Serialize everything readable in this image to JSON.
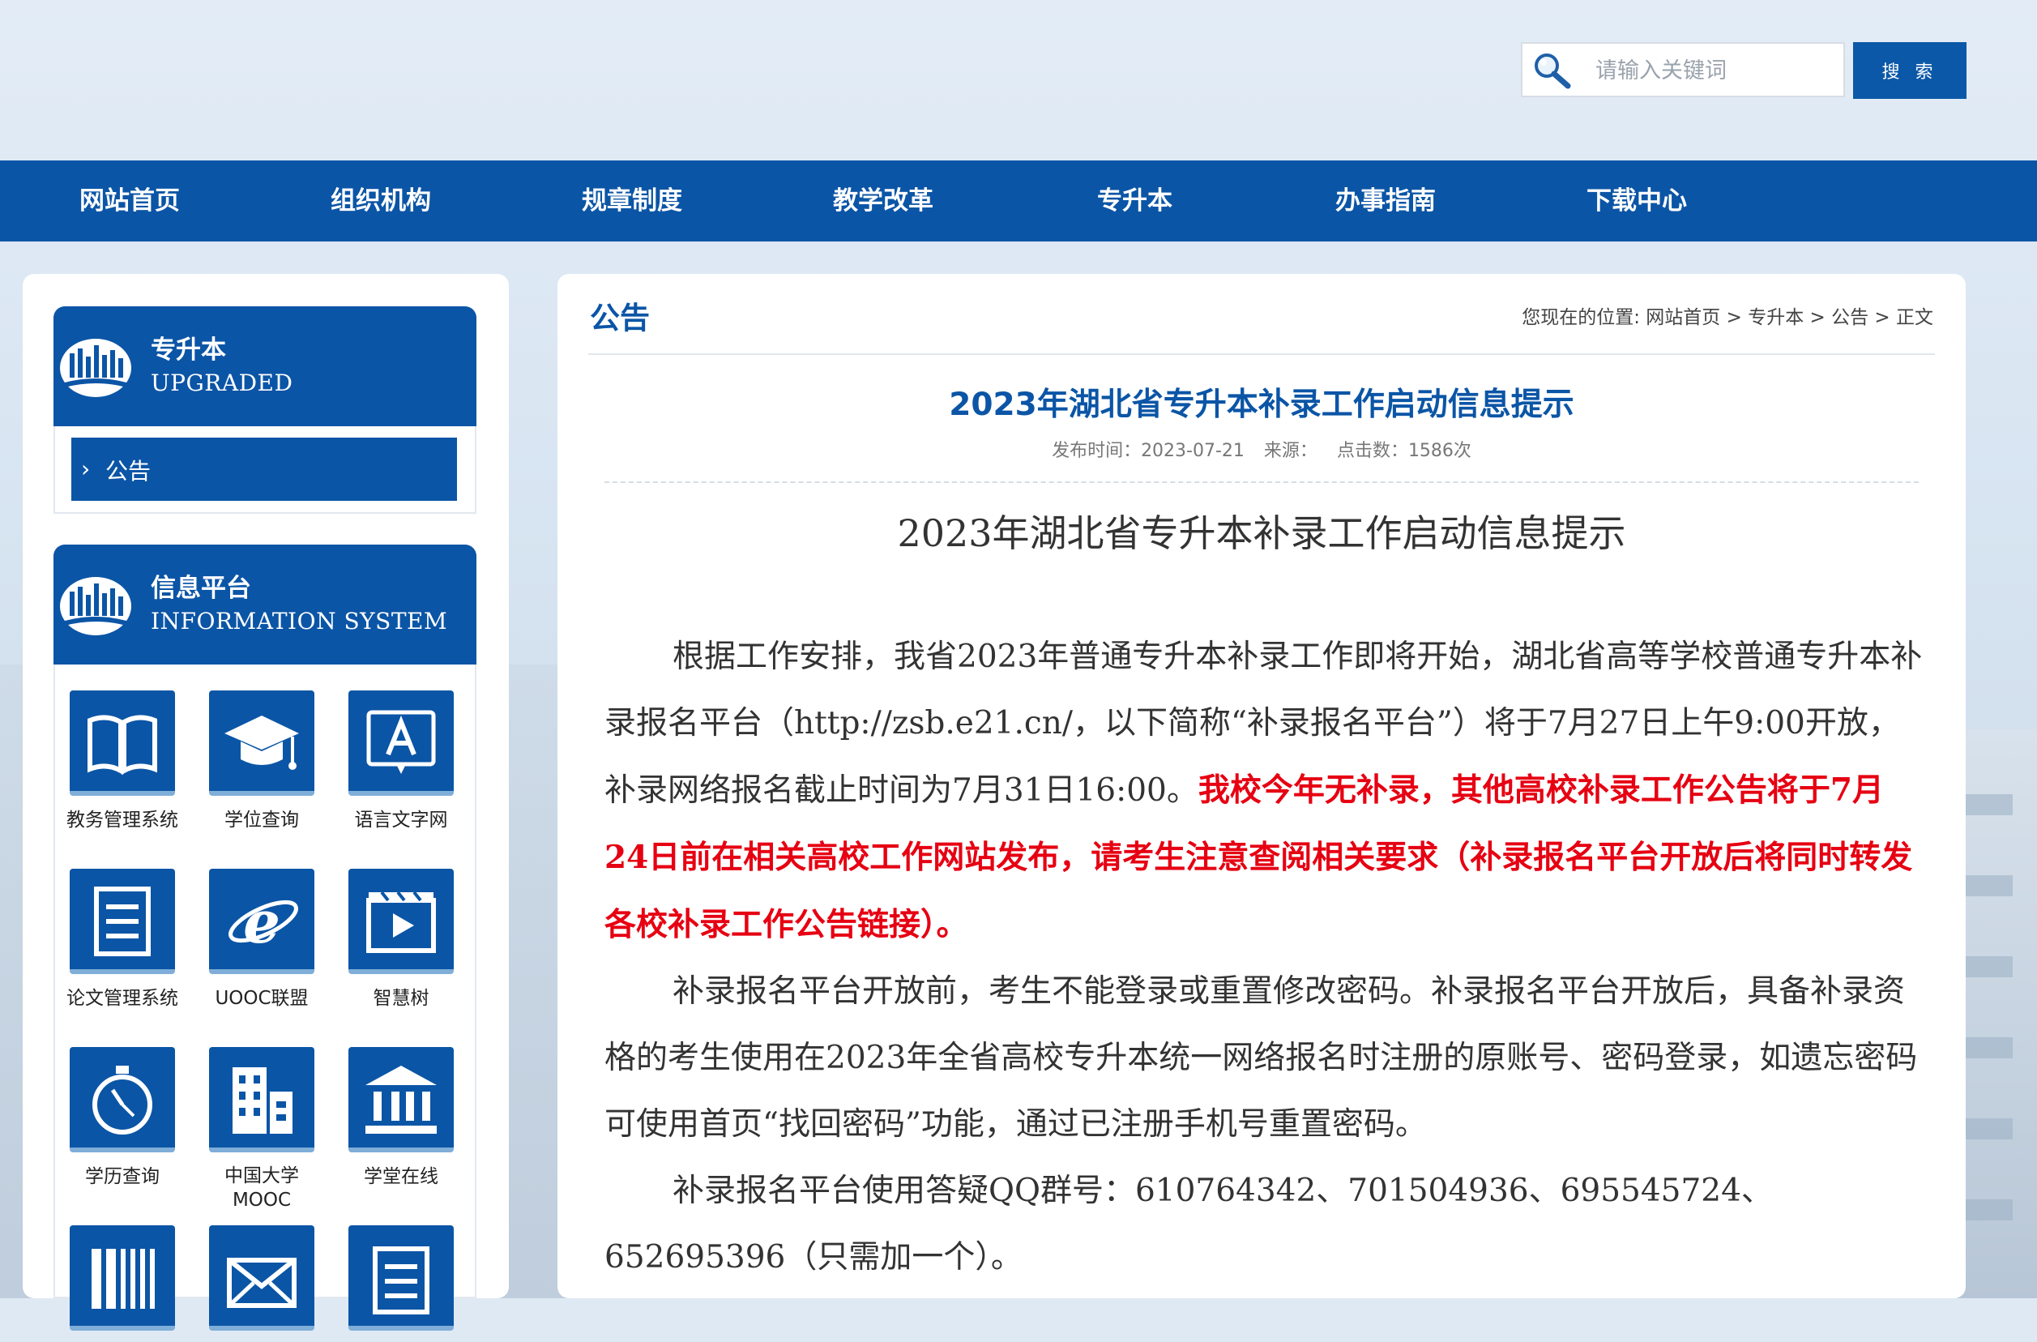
{
  "search": {
    "placeholder": "请输入关键词",
    "button_label": "搜 索"
  },
  "nav": {
    "items": [
      "网站首页",
      "组织机构",
      "规章制度",
      "教学改革",
      "专升本",
      "办事指南",
      "下载中心"
    ]
  },
  "sidebar": {
    "upgraded": {
      "title_cn": "专升本",
      "title_en": "UPGRADED",
      "sub_items": [
        {
          "label": "公告"
        }
      ]
    },
    "info": {
      "title_cn": "信息平台",
      "title_en": "INFORMATION SYSTEM",
      "tiles": [
        {
          "label": "教务管理系统",
          "icon": "book-icon"
        },
        {
          "label": "学位查询",
          "icon": "graduation-cap-icon"
        },
        {
          "label": "语言文字网",
          "icon": "letter-a-icon"
        },
        {
          "label": "论文管理系统",
          "icon": "document-lines-icon"
        },
        {
          "label": "UOOC联盟",
          "icon": "ie-browser-icon"
        },
        {
          "label": "智慧树",
          "icon": "video-play-icon"
        },
        {
          "label": "学历查询",
          "icon": "stopwatch-icon"
        },
        {
          "label": "中国大学\nMOOC",
          "icon": "building-icon"
        },
        {
          "label": "学堂在线",
          "icon": "institution-icon"
        },
        {
          "label": "",
          "icon": "bookshelf-icon"
        },
        {
          "label": "",
          "icon": "envelope-icon"
        },
        {
          "label": "",
          "icon": "list-document-icon"
        }
      ]
    }
  },
  "main": {
    "category": "公告",
    "breadcrumb": "您现在的位置: 网站首页 > 专升本 > 公告 > 正文",
    "title": "2023年湖北省专升本补录工作启动信息提示",
    "meta": {
      "date": "发布时间：2023-07-21",
      "source": "来源：",
      "clicks": "点击数：1586次"
    },
    "subtitle": "2023年湖北省专升本补录工作启动信息提示",
    "para1_normal": "根据工作安排，我省2023年普通专升本补录工作即将开始，湖北省高等学校普通专升本补录报名平台（http://zsb.e21.cn/，以下简称“补录报名平台”）将于7月27日上午9:00开放，补录网络报名截止时间为7月31日16:00。",
    "para1_red": "我校今年无补录，其他高校补录工作公告将于7月24日前在相关高校工作网站发布，请考生注意查阅相关要求（补录报名平台开放后将同时转发各校补录工作公告链接）。",
    "para2": "补录报名平台开放前，考生不能登录或重置修改密码。补录报名平台开放后，具备补录资格的考生使用在2023年全省高校专升本统一网络报名时注册的原账号、密码登录，如遗忘密码可使用首页“找回密码”功能，通过已注册手机号重置密码。",
    "para3": "补录报名平台使用答疑QQ群号：610764342、701504936、695545724、652695396（只需加一个）。"
  }
}
